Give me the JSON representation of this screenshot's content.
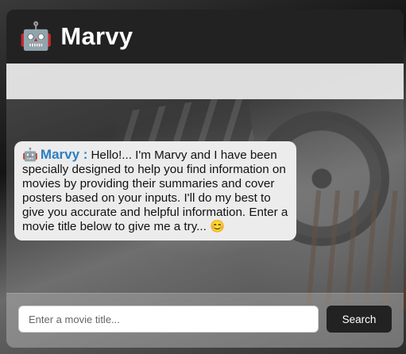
{
  "header": {
    "logo_icon": "🤖",
    "title": "Marvy"
  },
  "chat": {
    "messages": [
      {
        "icon": "🤖",
        "sender": "Marvy :",
        "text": "Hello!... I'm Marvy and I have been specially designed to help you find information on movies by providing their summaries and cover posters based on your inputs. I'll do my best to give you accurate and helpful information. Enter a movie title below to give me a try... 😊"
      }
    ]
  },
  "input": {
    "placeholder": "Enter a movie title...",
    "value": ""
  },
  "search_button": {
    "label": "Search"
  },
  "colors": {
    "header_bg": "#222222",
    "sender_name": "#2b7fc4",
    "bubble_bg": "#ececec",
    "button_bg": "#222222"
  }
}
